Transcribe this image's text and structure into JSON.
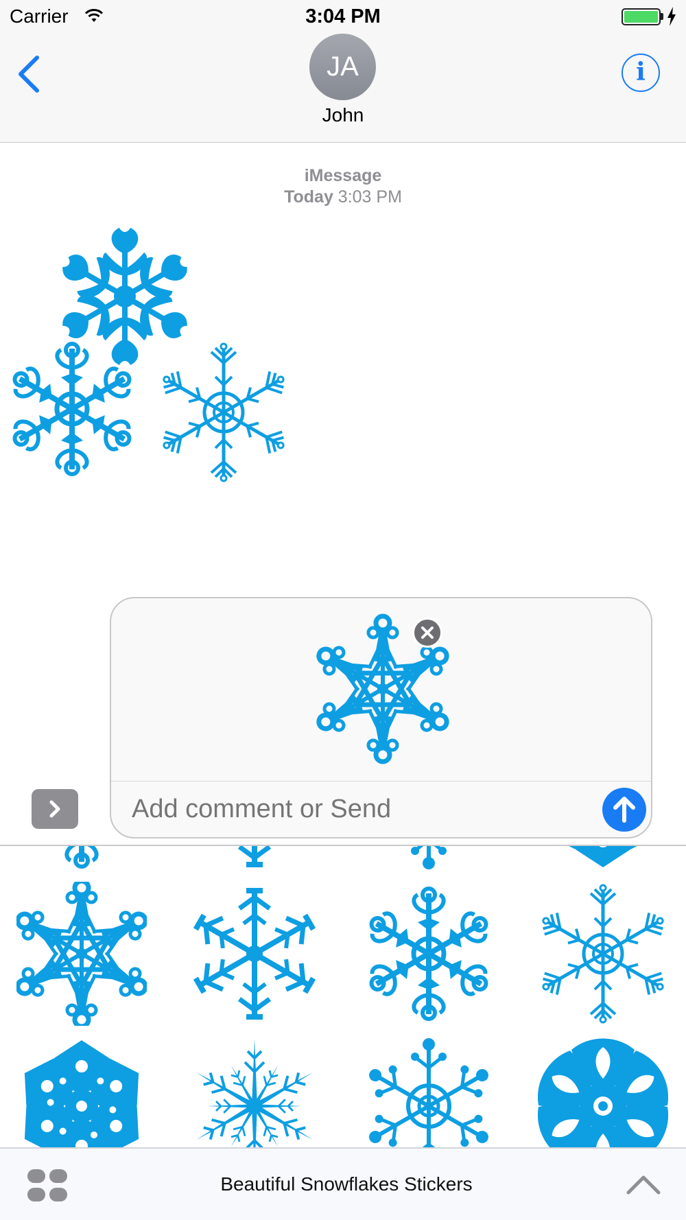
{
  "status_bar": {
    "carrier": "Carrier",
    "time": "3:04 PM",
    "battery_level": 1.0,
    "charging": true
  },
  "header": {
    "avatar_initials": "JA",
    "contact_name": "John",
    "info_glyph": "i",
    "back_icon": "chevron-left-icon"
  },
  "conversation": {
    "service": "iMessage",
    "day": "Today",
    "time": "3:03 PM"
  },
  "compose": {
    "placeholder": "Add comment or Send",
    "send_icon": "arrow-up-icon",
    "remove_icon": "close-icon",
    "apps_toggle_icon": "chevron-right-icon"
  },
  "sticker_drawer": {
    "title": "Beautiful Snowflakes Stickers",
    "columns": 4,
    "sticker_icon": "snowflake-icon"
  },
  "colors": {
    "accent": "#1a7cf5",
    "sticker": "#0e9ee2",
    "secondary_text": "#8e8e93",
    "bar_background": "#f7f7f7"
  }
}
